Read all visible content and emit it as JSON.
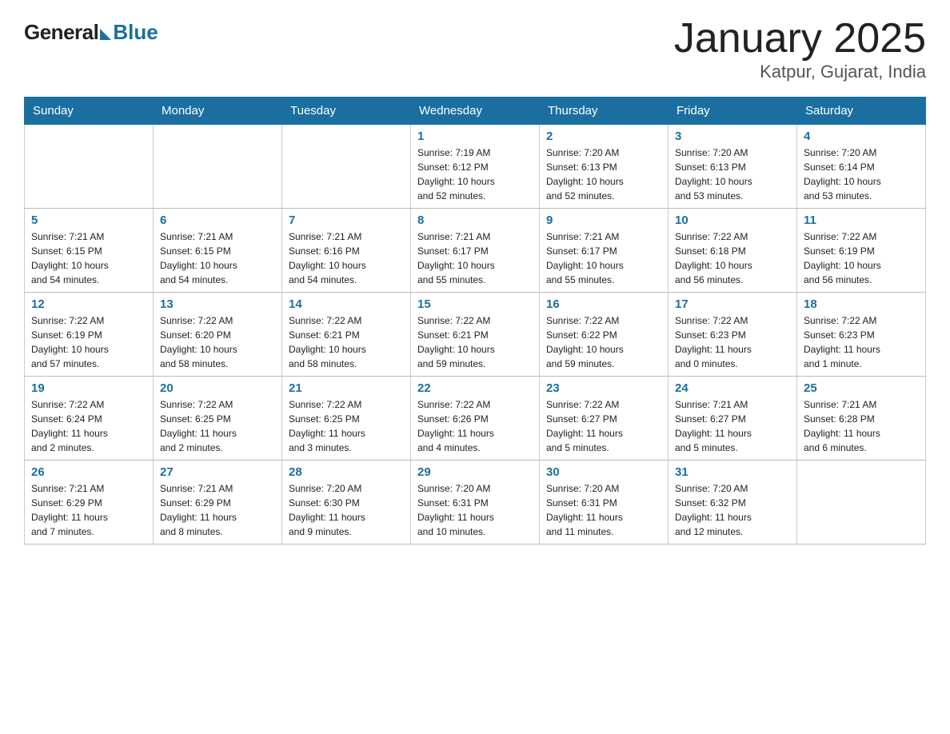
{
  "logo": {
    "general": "General",
    "blue": "Blue"
  },
  "title": "January 2025",
  "subtitle": "Katpur, Gujarat, India",
  "weekdays": [
    "Sunday",
    "Monday",
    "Tuesday",
    "Wednesday",
    "Thursday",
    "Friday",
    "Saturday"
  ],
  "weeks": [
    [
      {
        "day": "",
        "info": ""
      },
      {
        "day": "",
        "info": ""
      },
      {
        "day": "",
        "info": ""
      },
      {
        "day": "1",
        "info": "Sunrise: 7:19 AM\nSunset: 6:12 PM\nDaylight: 10 hours\nand 52 minutes."
      },
      {
        "day": "2",
        "info": "Sunrise: 7:20 AM\nSunset: 6:13 PM\nDaylight: 10 hours\nand 52 minutes."
      },
      {
        "day": "3",
        "info": "Sunrise: 7:20 AM\nSunset: 6:13 PM\nDaylight: 10 hours\nand 53 minutes."
      },
      {
        "day": "4",
        "info": "Sunrise: 7:20 AM\nSunset: 6:14 PM\nDaylight: 10 hours\nand 53 minutes."
      }
    ],
    [
      {
        "day": "5",
        "info": "Sunrise: 7:21 AM\nSunset: 6:15 PM\nDaylight: 10 hours\nand 54 minutes."
      },
      {
        "day": "6",
        "info": "Sunrise: 7:21 AM\nSunset: 6:15 PM\nDaylight: 10 hours\nand 54 minutes."
      },
      {
        "day": "7",
        "info": "Sunrise: 7:21 AM\nSunset: 6:16 PM\nDaylight: 10 hours\nand 54 minutes."
      },
      {
        "day": "8",
        "info": "Sunrise: 7:21 AM\nSunset: 6:17 PM\nDaylight: 10 hours\nand 55 minutes."
      },
      {
        "day": "9",
        "info": "Sunrise: 7:21 AM\nSunset: 6:17 PM\nDaylight: 10 hours\nand 55 minutes."
      },
      {
        "day": "10",
        "info": "Sunrise: 7:22 AM\nSunset: 6:18 PM\nDaylight: 10 hours\nand 56 minutes."
      },
      {
        "day": "11",
        "info": "Sunrise: 7:22 AM\nSunset: 6:19 PM\nDaylight: 10 hours\nand 56 minutes."
      }
    ],
    [
      {
        "day": "12",
        "info": "Sunrise: 7:22 AM\nSunset: 6:19 PM\nDaylight: 10 hours\nand 57 minutes."
      },
      {
        "day": "13",
        "info": "Sunrise: 7:22 AM\nSunset: 6:20 PM\nDaylight: 10 hours\nand 58 minutes."
      },
      {
        "day": "14",
        "info": "Sunrise: 7:22 AM\nSunset: 6:21 PM\nDaylight: 10 hours\nand 58 minutes."
      },
      {
        "day": "15",
        "info": "Sunrise: 7:22 AM\nSunset: 6:21 PM\nDaylight: 10 hours\nand 59 minutes."
      },
      {
        "day": "16",
        "info": "Sunrise: 7:22 AM\nSunset: 6:22 PM\nDaylight: 10 hours\nand 59 minutes."
      },
      {
        "day": "17",
        "info": "Sunrise: 7:22 AM\nSunset: 6:23 PM\nDaylight: 11 hours\nand 0 minutes."
      },
      {
        "day": "18",
        "info": "Sunrise: 7:22 AM\nSunset: 6:23 PM\nDaylight: 11 hours\nand 1 minute."
      }
    ],
    [
      {
        "day": "19",
        "info": "Sunrise: 7:22 AM\nSunset: 6:24 PM\nDaylight: 11 hours\nand 2 minutes."
      },
      {
        "day": "20",
        "info": "Sunrise: 7:22 AM\nSunset: 6:25 PM\nDaylight: 11 hours\nand 2 minutes."
      },
      {
        "day": "21",
        "info": "Sunrise: 7:22 AM\nSunset: 6:25 PM\nDaylight: 11 hours\nand 3 minutes."
      },
      {
        "day": "22",
        "info": "Sunrise: 7:22 AM\nSunset: 6:26 PM\nDaylight: 11 hours\nand 4 minutes."
      },
      {
        "day": "23",
        "info": "Sunrise: 7:22 AM\nSunset: 6:27 PM\nDaylight: 11 hours\nand 5 minutes."
      },
      {
        "day": "24",
        "info": "Sunrise: 7:21 AM\nSunset: 6:27 PM\nDaylight: 11 hours\nand 5 minutes."
      },
      {
        "day": "25",
        "info": "Sunrise: 7:21 AM\nSunset: 6:28 PM\nDaylight: 11 hours\nand 6 minutes."
      }
    ],
    [
      {
        "day": "26",
        "info": "Sunrise: 7:21 AM\nSunset: 6:29 PM\nDaylight: 11 hours\nand 7 minutes."
      },
      {
        "day": "27",
        "info": "Sunrise: 7:21 AM\nSunset: 6:29 PM\nDaylight: 11 hours\nand 8 minutes."
      },
      {
        "day": "28",
        "info": "Sunrise: 7:20 AM\nSunset: 6:30 PM\nDaylight: 11 hours\nand 9 minutes."
      },
      {
        "day": "29",
        "info": "Sunrise: 7:20 AM\nSunset: 6:31 PM\nDaylight: 11 hours\nand 10 minutes."
      },
      {
        "day": "30",
        "info": "Sunrise: 7:20 AM\nSunset: 6:31 PM\nDaylight: 11 hours\nand 11 minutes."
      },
      {
        "day": "31",
        "info": "Sunrise: 7:20 AM\nSunset: 6:32 PM\nDaylight: 11 hours\nand 12 minutes."
      },
      {
        "day": "",
        "info": ""
      }
    ]
  ]
}
